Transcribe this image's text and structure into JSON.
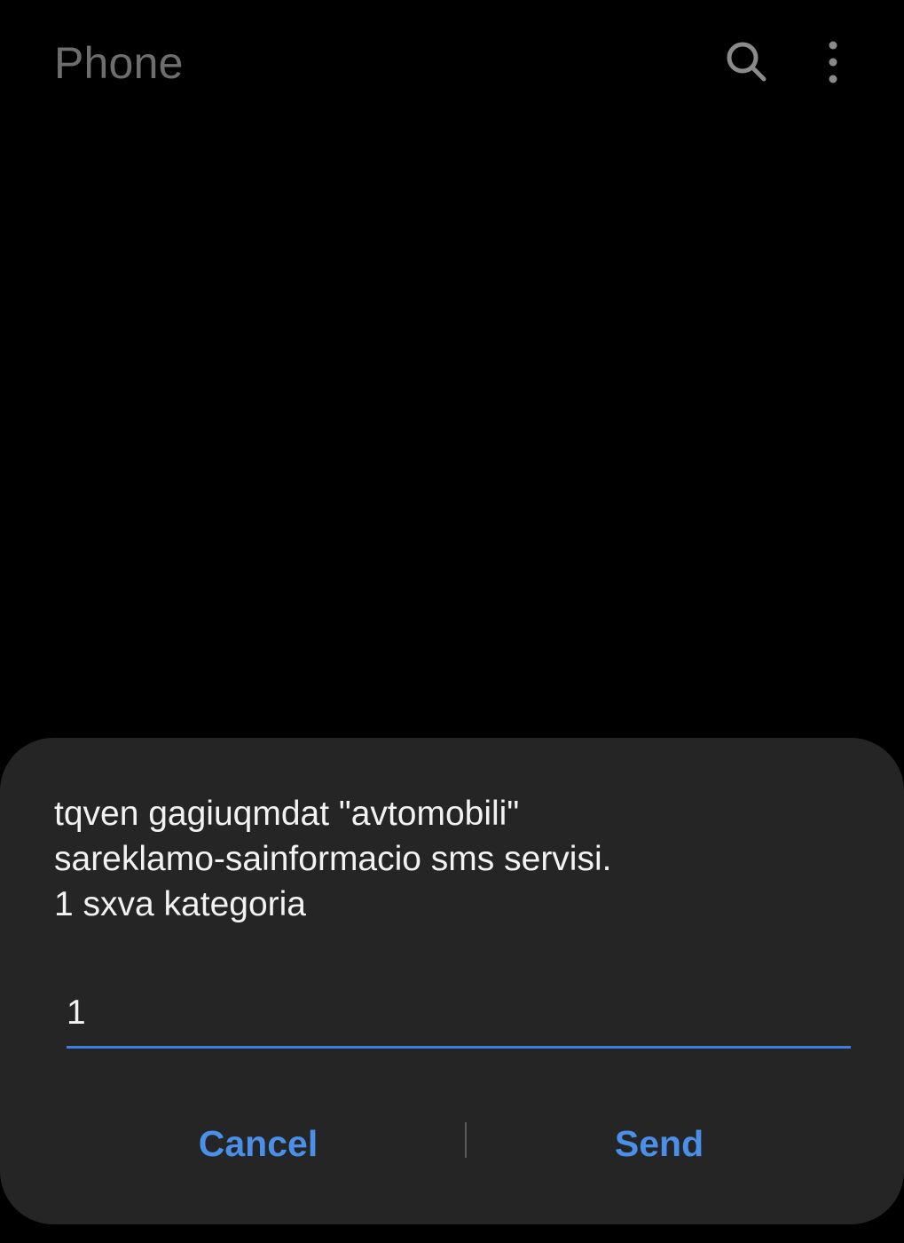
{
  "header": {
    "title": "Phone",
    "search_icon": "search-icon",
    "more_icon": "more-vertical-icon",
    "icon_color": "#8a8a8a"
  },
  "dialog": {
    "message_lines": [
      "tqven gagiuqmdat \"avtomobili\"",
      "sareklamo-sainformacio sms servisi.",
      "1 sxva kategoria"
    ],
    "input_value": "1",
    "cancel_label": "Cancel",
    "send_label": "Send",
    "accent_color": "#3d7fe0",
    "background_color": "#252525"
  }
}
